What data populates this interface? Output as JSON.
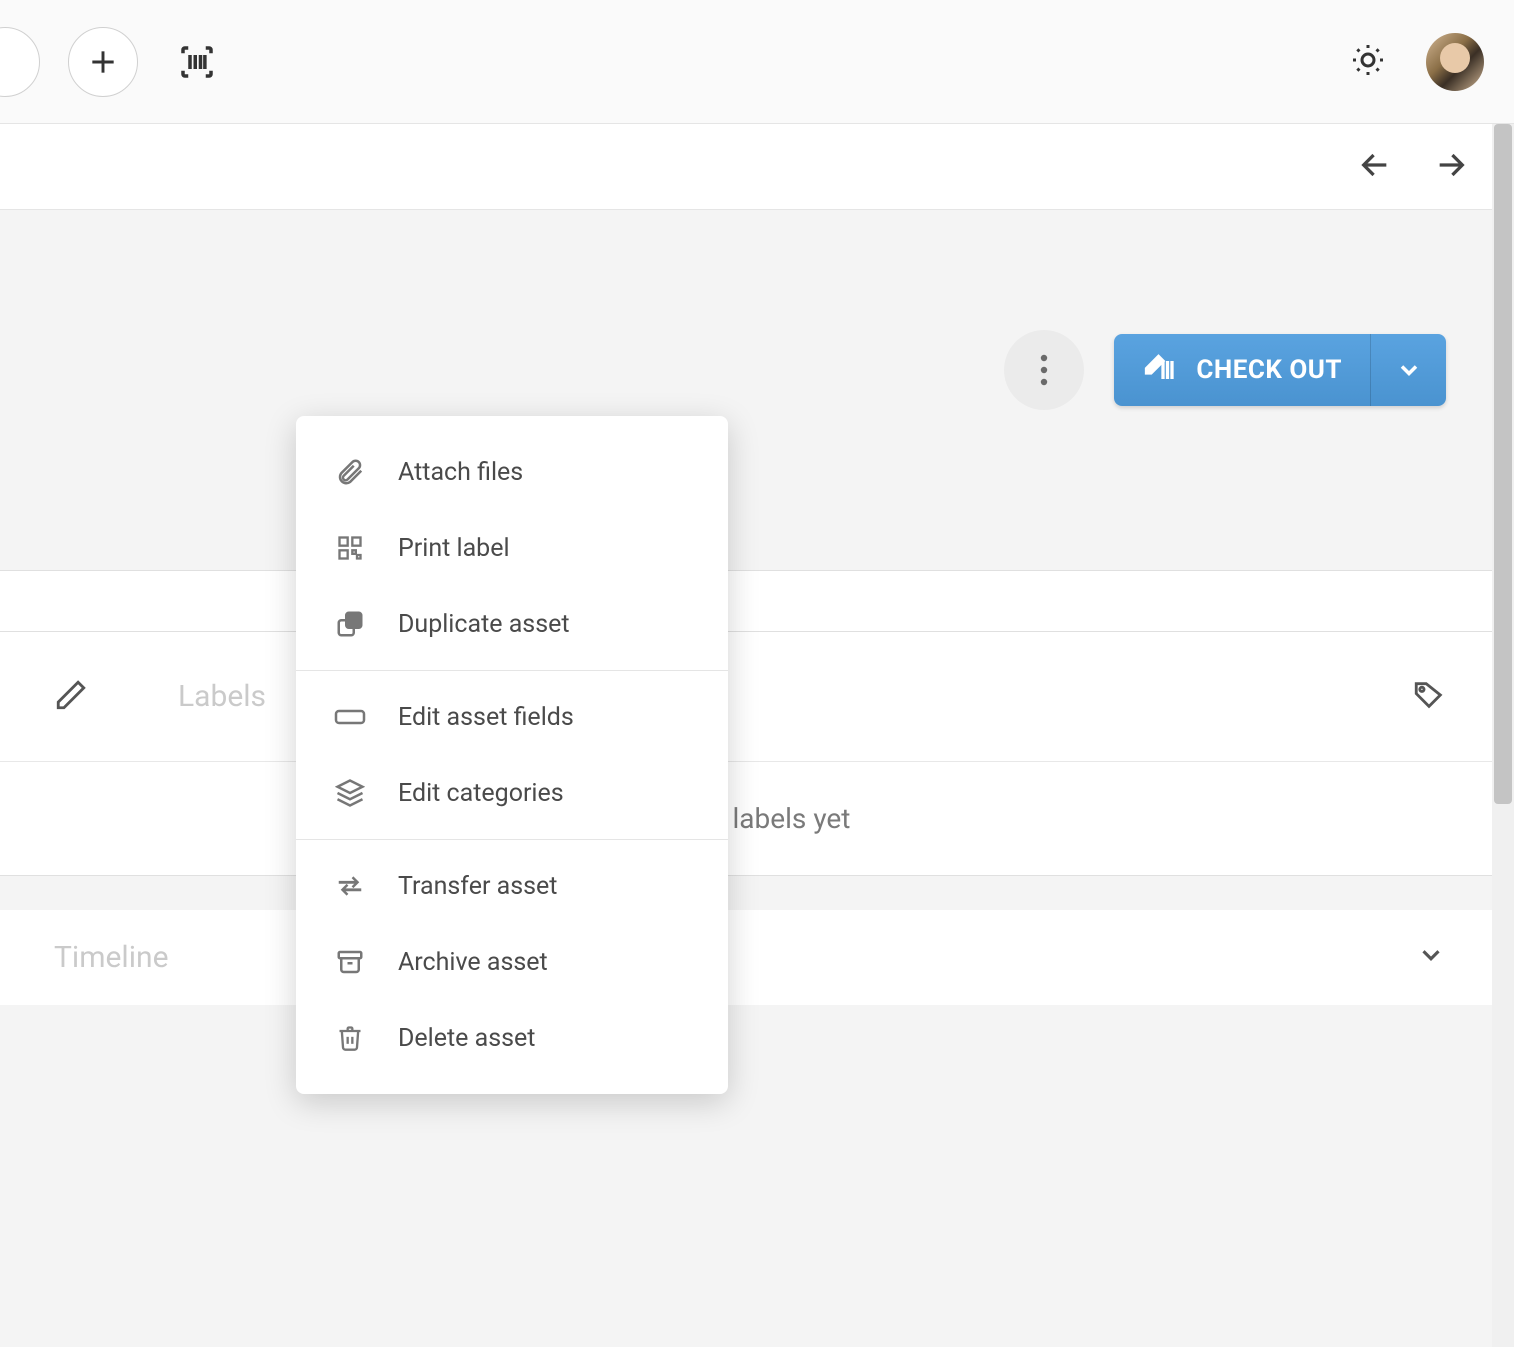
{
  "header": {
    "add_tooltip": "Add",
    "scan_tooltip": "Scan barcode",
    "theme_tooltip": "Toggle theme"
  },
  "nav": {
    "prev_tooltip": "Previous",
    "next_tooltip": "Next"
  },
  "actions": {
    "more_tooltip": "More actions",
    "checkout_label": "CHECK OUT"
  },
  "menu": {
    "items": [
      {
        "label": "Attach files"
      },
      {
        "label": "Print label"
      },
      {
        "label": "Duplicate asset"
      },
      {
        "label": "Edit asset fields"
      },
      {
        "label": "Edit categories"
      },
      {
        "label": "Transfer asset"
      },
      {
        "label": "Archive asset"
      },
      {
        "label": "Delete asset"
      }
    ]
  },
  "labels": {
    "title": "Labels",
    "empty": "No labels yet"
  },
  "timeline": {
    "title": "Timeline"
  }
}
